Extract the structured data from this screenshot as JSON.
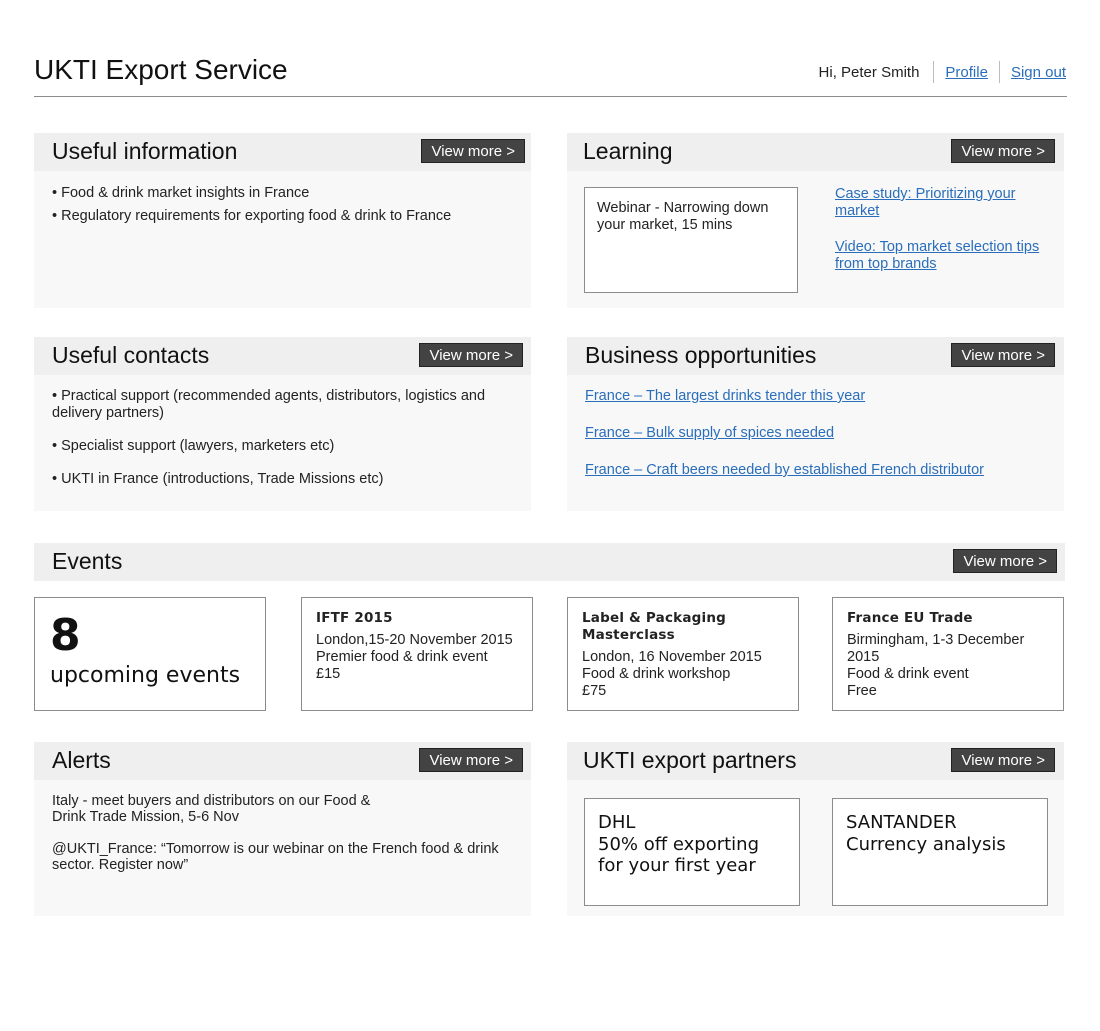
{
  "header": {
    "title": "UKTI Export Service",
    "greeting": "Hi, Peter Smith",
    "profile_link": "Profile",
    "signout_link": "Sign out"
  },
  "useful_information": {
    "title": "Useful information",
    "view_more": "View more >",
    "items": [
      "Food & drink market insights in France",
      "Regulatory requirements for exporting food & drink to France"
    ]
  },
  "learning": {
    "title": "Learning",
    "view_more": "View more >",
    "webinar": "Webinar - Narrowing down your market, 15 mins",
    "links": [
      "Case study: Prioritizing your market",
      "Video: Top market selection tips from top brands"
    ]
  },
  "useful_contacts": {
    "title": "Useful contacts",
    "view_more": "View more >",
    "items": [
      "Practical support (recommended agents, distributors, logistics and delivery partners)",
      "Specialist support (lawyers, marketers etc)",
      "UKTI in France (introductions, Trade Missions etc)"
    ]
  },
  "business_opportunities": {
    "title": "Business opportunities",
    "view_more": "View more >",
    "links": [
      "France – The largest drinks tender this year",
      "France – Bulk supply of spices needed",
      "France – Craft beers needed by established French distributor"
    ]
  },
  "events": {
    "title": "Events",
    "view_more": "View more >",
    "count": "8",
    "count_label": "upcoming events",
    "cards": [
      {
        "name": "IFTF 2015",
        "where": "London,15-20 November 2015",
        "desc": "Premier food & drink event",
        "price": "£15"
      },
      {
        "name": "Label & Packaging Masterclass",
        "where": "London, 16 November 2015",
        "desc": "Food & drink workshop",
        "price": "£75"
      },
      {
        "name": "France EU Trade",
        "where": "Birmingham, 1-3 December 2015",
        "desc": "Food & drink event",
        "price": "Free"
      }
    ]
  },
  "alerts": {
    "title": "Alerts",
    "view_more": "View more >",
    "messages": [
      "Italy - meet buyers and distributors on our Food & Drink Trade Mission, 5-6 Nov",
      "@UKTI_France: “Tomorrow is our webinar on the French food & drink sector. Register now”"
    ]
  },
  "partners": {
    "title": "UKTI export partners",
    "view_more": "View more >",
    "cards": [
      {
        "name": "DHL",
        "offer": "50% off exporting for your first year"
      },
      {
        "name": "SANTANDER",
        "offer": "Currency analysis"
      }
    ]
  }
}
